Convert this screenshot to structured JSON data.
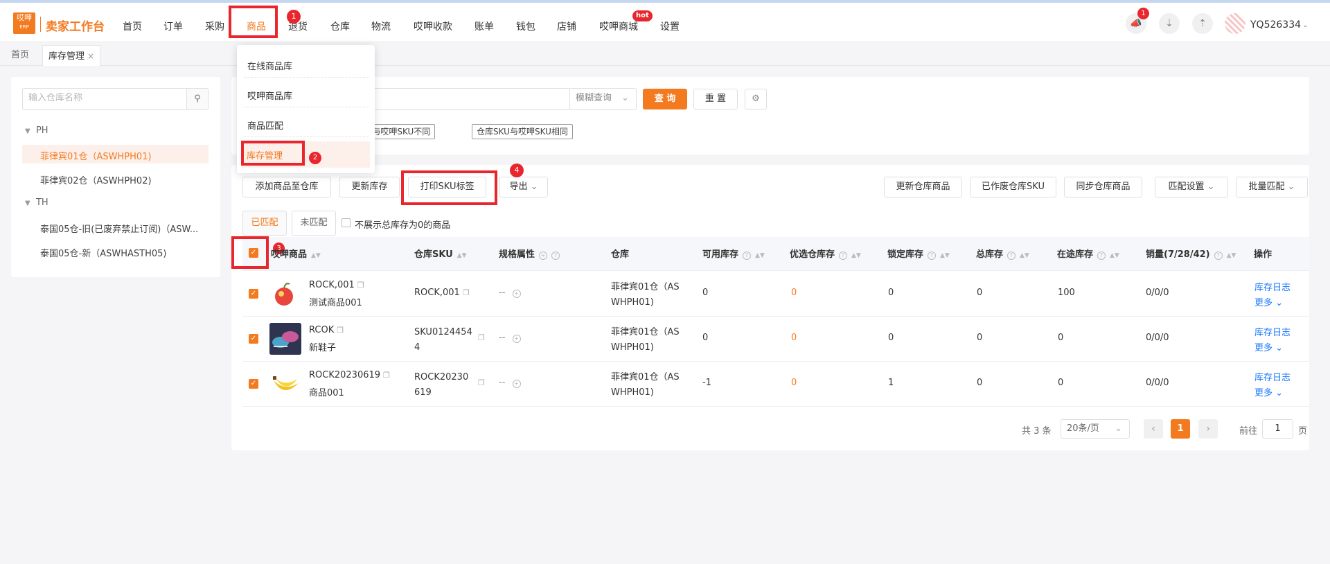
{
  "header": {
    "logo_badge": "哎呷",
    "logo_erp": "ERP",
    "logo_text": "卖家工作台",
    "nav": [
      "首页",
      "订单",
      "采购",
      "商品",
      "退货",
      "仓库",
      "物流",
      "哎呷收款",
      "账单",
      "钱包",
      "店铺",
      "哎呷商城",
      "设置"
    ],
    "active_nav": "商品",
    "hot_badge": "hot",
    "notification_count": "1",
    "username": "YQ526334"
  },
  "tabs": {
    "home": "首页",
    "current": "库存管理",
    "close": "×"
  },
  "sidebar": {
    "search_placeholder": "输入仓库名称",
    "groups": [
      {
        "name": "PH",
        "items": [
          "菲律宾01仓（ASWHPH01)",
          "菲律宾02仓（ASWHPH02)"
        ]
      },
      {
        "name": "TH",
        "items": [
          "泰国05仓-旧(已废弃禁止订阅)（ASW...",
          "泰国05仓-新（ASWHASTH05)"
        ]
      }
    ]
  },
  "filter": {
    "mode": "模糊查询",
    "query_btn": "查 询",
    "reset_btn": "重 置",
    "tag1": "KU与哎呷SKU不同",
    "tag2": "仓库SKU与哎呷SKU相同"
  },
  "dropdown": {
    "items": [
      "在线商品库",
      "哎呷商品库",
      "商品匹配",
      "库存管理"
    ]
  },
  "toolbar": {
    "add": "添加商品至仓库",
    "update_stock": "更新库存",
    "print_sku": "打印SKU标签",
    "export": "导出",
    "update_wh": "更新仓库商品",
    "abandoned_sku": "已作废仓库SKU",
    "sync_wh": "同步仓库商品",
    "match_settings": "匹配设置",
    "batch_match": "批量匹配"
  },
  "match_tabs": {
    "matched": "已匹配",
    "unmatched": "未匹配",
    "hide_zero": "不展示总库存为0的商品"
  },
  "annotations": [
    "1",
    "2",
    "3",
    "4"
  ],
  "table": {
    "headers": [
      "哎呷商品",
      "仓库SKU",
      "规格属性",
      "仓库",
      "可用库存",
      "优选仓库存",
      "锁定库存",
      "总库存",
      "在途库存",
      "销量(7/28/42)",
      "操作"
    ],
    "rows": [
      {
        "sku_code": "ROCK,001",
        "product_name": "测试商品001",
        "wh_sku": [
          "ROCK,001"
        ],
        "spec": "--",
        "warehouse": [
          "菲律宾01仓（AS",
          "WHPH01)"
        ],
        "available": "0",
        "preferred": "0",
        "locked": "0",
        "total": "0",
        "transit": "100",
        "sales": "0/0/0",
        "log": "库存日志",
        "more": "更多"
      },
      {
        "sku_code": "RCOK",
        "product_name": "新鞋子",
        "wh_sku": [
          "SKU0124454",
          "4"
        ],
        "spec": "--",
        "warehouse": [
          "菲律宾01仓（AS",
          "WHPH01)"
        ],
        "available": "0",
        "preferred": "0",
        "locked": "0",
        "total": "0",
        "transit": "0",
        "sales": "0/0/0",
        "log": "库存日志",
        "more": "更多"
      },
      {
        "sku_code": "ROCK20230619",
        "product_name": "商品001",
        "wh_sku": [
          "ROCK20230",
          "619"
        ],
        "spec": "--",
        "warehouse": [
          "菲律宾01仓（AS",
          "WHPH01)"
        ],
        "available": "-1",
        "preferred": "0",
        "locked": "1",
        "total": "0",
        "transit": "0",
        "sales": "0/0/0",
        "log": "库存日志",
        "more": "更多"
      }
    ]
  },
  "pagination": {
    "total": "共 3 条",
    "page_size": "20条/页",
    "current": "1",
    "goto_label": "前往",
    "goto_value": "1",
    "page_unit": "页"
  }
}
